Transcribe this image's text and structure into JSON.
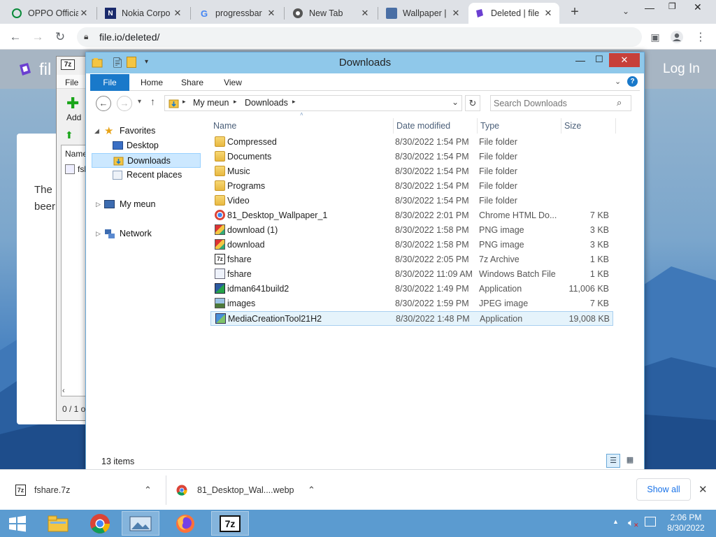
{
  "browser": {
    "tabs": [
      {
        "title": "OPPO Official",
        "icon": "oppo-icon",
        "active": false
      },
      {
        "title": "Nokia Corpo",
        "icon": "nokia-icon",
        "active": false
      },
      {
        "title": "progressbar",
        "icon": "google-icon",
        "active": false
      },
      {
        "title": "New Tab",
        "icon": "chrome-icon",
        "active": false
      },
      {
        "title": "Wallpaper | ",
        "icon": "wallpaper-icon",
        "active": false
      },
      {
        "title": "Deleted | file",
        "icon": "fileio-icon",
        "active": true
      }
    ],
    "address": "file.io/deleted/"
  },
  "site": {
    "logo_text": "fil",
    "login_label": "Log In",
    "card_text_1": "The",
    "card_text_2": "beer"
  },
  "sevenzip": {
    "menu_file": "File",
    "add_label": "Add",
    "col_name": "Name",
    "row_name": "fsh",
    "status": "0 / 1 o"
  },
  "explorer": {
    "title": "Downloads",
    "ribbon_tabs": [
      "File",
      "Home",
      "Share",
      "View"
    ],
    "breadcrumb": [
      "My meun",
      "Downloads"
    ],
    "search_placeholder": "Search Downloads",
    "nav": {
      "favorites": "Favorites",
      "desktop": "Desktop",
      "downloads": "Downloads",
      "recent": "Recent places",
      "pc": "My meun",
      "network": "Network"
    },
    "columns": {
      "name": "Name",
      "date": "Date modified",
      "type": "Type",
      "size": "Size"
    },
    "files": [
      {
        "name": "Compressed",
        "date": "8/30/2022 1:54 PM",
        "type": "File folder",
        "size": "",
        "icon": "folder-icon"
      },
      {
        "name": "Documents",
        "date": "8/30/2022 1:54 PM",
        "type": "File folder",
        "size": "",
        "icon": "folder-icon"
      },
      {
        "name": "Music",
        "date": "8/30/2022 1:54 PM",
        "type": "File folder",
        "size": "",
        "icon": "folder-icon"
      },
      {
        "name": "Programs",
        "date": "8/30/2022 1:54 PM",
        "type": "File folder",
        "size": "",
        "icon": "folder-icon"
      },
      {
        "name": "Video",
        "date": "8/30/2022 1:54 PM",
        "type": "File folder",
        "size": "",
        "icon": "folder-icon"
      },
      {
        "name": "81_Desktop_Wallpaper_1",
        "date": "8/30/2022 2:01 PM",
        "type": "Chrome HTML Do...",
        "size": "7 KB",
        "icon": "chrome-file-icon"
      },
      {
        "name": "download (1)",
        "date": "8/30/2022 1:58 PM",
        "type": "PNG image",
        "size": "3 KB",
        "icon": "image-file-icon"
      },
      {
        "name": "download",
        "date": "8/30/2022 1:58 PM",
        "type": "PNG image",
        "size": "3 KB",
        "icon": "image-file-icon"
      },
      {
        "name": "fshare",
        "date": "8/30/2022 2:05 PM",
        "type": "7z Archive",
        "size": "1 KB",
        "icon": "archive-file-icon"
      },
      {
        "name": "fshare",
        "date": "8/30/2022 11:09 AM",
        "type": "Windows Batch File",
        "size": "1 KB",
        "icon": "batch-file-icon"
      },
      {
        "name": "idman641build2",
        "date": "8/30/2022 1:49 PM",
        "type": "Application",
        "size": "11,006 KB",
        "icon": "idm-app-icon"
      },
      {
        "name": "images",
        "date": "8/30/2022 1:59 PM",
        "type": "JPEG image",
        "size": "7 KB",
        "icon": "jpeg-file-icon"
      },
      {
        "name": "MediaCreationTool21H2",
        "date": "8/30/2022 1:48 PM",
        "type": "Application",
        "size": "19,008 KB",
        "icon": "setup-app-icon",
        "selected": true
      }
    ],
    "status": "13 items"
  },
  "downloads_shelf": {
    "items": [
      {
        "name": "fshare.7z",
        "icon": "archive-file-icon"
      },
      {
        "name": "81_Desktop_Wal....webp",
        "icon": "chrome-icon"
      }
    ],
    "show_all": "Show all"
  },
  "taskbar": {
    "time": "2:06 PM",
    "date": "8/30/2022"
  },
  "colors": {
    "explorer_title": "#8fc8ea",
    "ribbon_file": "#1979ca",
    "selection": "#e5f3fb",
    "taskbar": "#5b9bd0"
  }
}
